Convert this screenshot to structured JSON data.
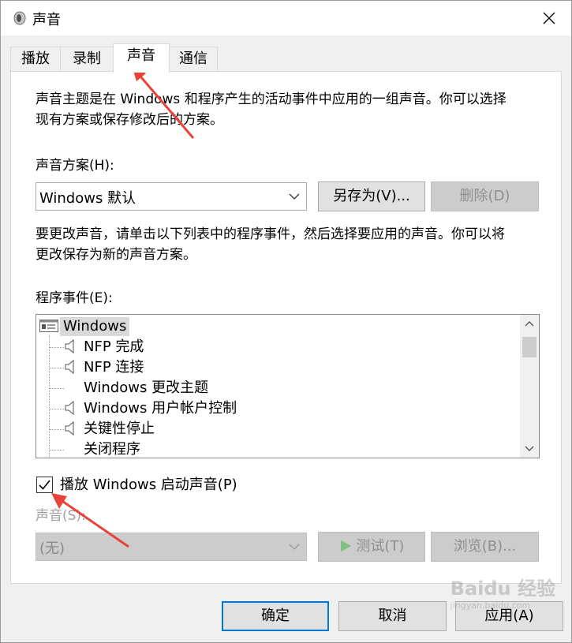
{
  "window": {
    "title": "声音"
  },
  "tabs": [
    {
      "label": "播放"
    },
    {
      "label": "录制"
    },
    {
      "label": "声音"
    },
    {
      "label": "通信"
    }
  ],
  "panel": {
    "intro_line1": "声音主题是在 Windows 和程序产生的活动事件中应用的一组声音。你可以选择",
    "intro_line2": "现有方案或保存修改后的方案。",
    "scheme_label": "声音方案(H):",
    "scheme_value": "Windows 默认",
    "save_as_label": "另存为(V)...",
    "delete_label": "删除(D)",
    "instr_line1": "要更改声音，请单击以下列表中的程序事件，然后选择要应用的声音。你可以将",
    "instr_line2": "更改保存为新的声音方案。",
    "events_label": "程序事件(E):",
    "events_root": "Windows",
    "events": [
      {
        "label": "NFP 完成",
        "has_sound": true
      },
      {
        "label": "NFP 连接",
        "has_sound": true
      },
      {
        "label": "Windows 更改主题",
        "has_sound": false
      },
      {
        "label": "Windows 用户帐户控制",
        "has_sound": true
      },
      {
        "label": "关键性停止",
        "has_sound": true
      },
      {
        "label": "关闭程序",
        "has_sound": false
      }
    ],
    "startup_checkbox_label": "播放 Windows 启动声音(P)",
    "startup_checked": true,
    "sounds_label": "声音(S):",
    "sounds_value": "(无)",
    "test_label": "测试(T)",
    "browse_label": "浏览(B)..."
  },
  "footer": {
    "ok_label": "确定",
    "cancel_label": "取消",
    "apply_label": "应用(A)"
  },
  "watermark": {
    "main": "Baidu 经验",
    "sub": "jingyan.baidu.com"
  },
  "colors": {
    "annotation_arrow": "#e8433a",
    "focus_border": "#0078d7"
  }
}
